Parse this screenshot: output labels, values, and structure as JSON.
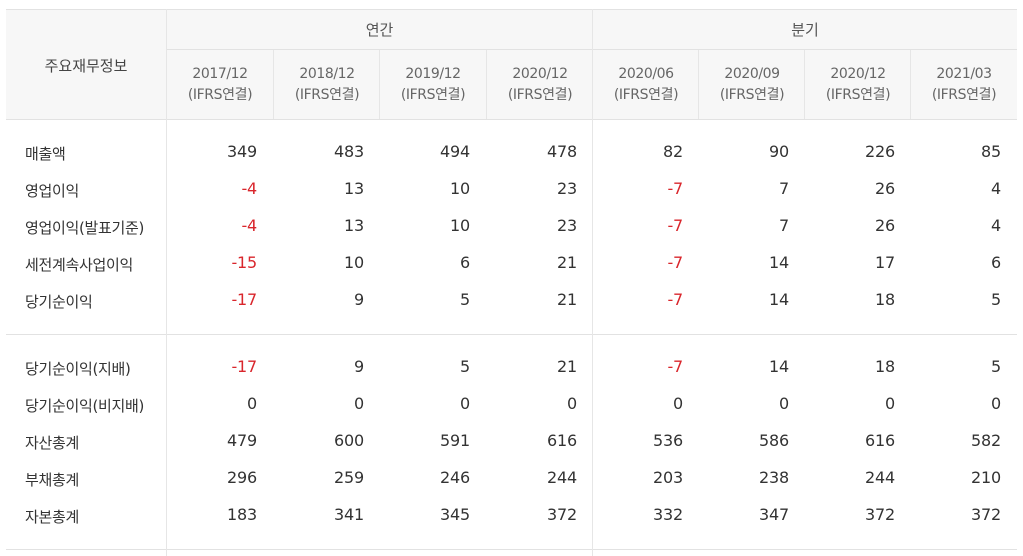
{
  "table": {
    "title": "주요재무정보",
    "groups": {
      "annual": "연간",
      "quarterly": "분기"
    },
    "periods": [
      {
        "date": "2017/12",
        "basis": "(IFRS연결)"
      },
      {
        "date": "2018/12",
        "basis": "(IFRS연결)"
      },
      {
        "date": "2019/12",
        "basis": "(IFRS연결)"
      },
      {
        "date": "2020/12",
        "basis": "(IFRS연결)"
      },
      {
        "date": "2020/06",
        "basis": "(IFRS연결)"
      },
      {
        "date": "2020/09",
        "basis": "(IFRS연결)"
      },
      {
        "date": "2020/12",
        "basis": "(IFRS연결)"
      },
      {
        "date": "2021/03",
        "basis": "(IFRS연결)"
      }
    ],
    "rows": [
      {
        "label": "매출액",
        "values": [
          "349",
          "483",
          "494",
          "478",
          "82",
          "90",
          "226",
          "85"
        ]
      },
      {
        "label": "영업이익",
        "values": [
          "-4",
          "13",
          "10",
          "23",
          "-7",
          "7",
          "26",
          "4"
        ]
      },
      {
        "label": "영업이익(발표기준)",
        "values": [
          "-4",
          "13",
          "10",
          "23",
          "-7",
          "7",
          "26",
          "4"
        ]
      },
      {
        "label": "세전계속사업이익",
        "values": [
          "-15",
          "10",
          "6",
          "21",
          "-7",
          "14",
          "17",
          "6"
        ]
      },
      {
        "label": "당기순이익",
        "values": [
          "-17",
          "9",
          "5",
          "21",
          "-7",
          "14",
          "18",
          "5"
        ]
      },
      {
        "label": "당기순이익(지배)",
        "values": [
          "-17",
          "9",
          "5",
          "21",
          "-7",
          "14",
          "18",
          "5"
        ]
      },
      {
        "label": "당기순이익(비지배)",
        "values": [
          "0",
          "0",
          "0",
          "0",
          "0",
          "0",
          "0",
          "0"
        ]
      },
      {
        "label": "자산총계",
        "values": [
          "479",
          "600",
          "591",
          "616",
          "536",
          "586",
          "616",
          "582"
        ]
      },
      {
        "label": "부채총계",
        "values": [
          "296",
          "259",
          "246",
          "244",
          "203",
          "238",
          "244",
          "210"
        ]
      },
      {
        "label": "자본총계",
        "values": [
          "183",
          "341",
          "345",
          "372",
          "332",
          "347",
          "372",
          "372"
        ]
      }
    ]
  },
  "colors": {
    "negative": "#d9262c",
    "text": "#333333",
    "header_bg": "#f7f7f7",
    "border": "#e2e2e2"
  }
}
